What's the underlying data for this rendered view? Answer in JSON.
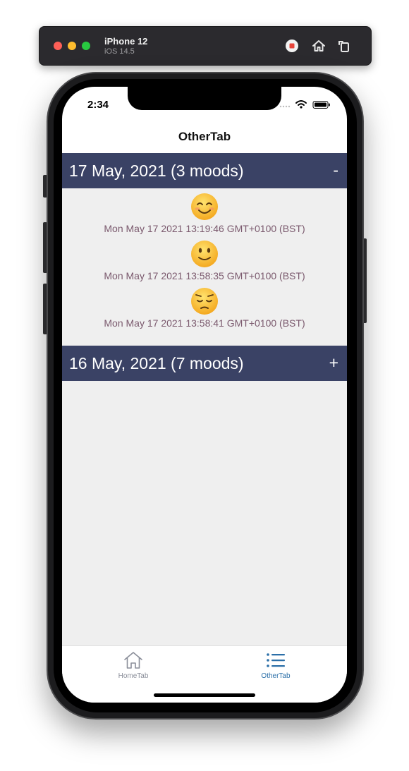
{
  "simulator": {
    "device": "iPhone 12",
    "os": "iOS 14.5"
  },
  "status_bar": {
    "time": "2:34"
  },
  "nav": {
    "title": "OtherTab"
  },
  "sections": [
    {
      "label": "17 May, 2021 (3 moods)",
      "toggle": "-",
      "expanded": true,
      "moods": [
        {
          "emoji_icon": "smiling-face-icon",
          "timestamp": "Mon May 17 2021 13:19:46 GMT+0100 (BST)"
        },
        {
          "emoji_icon": "slightly-smiling-face-icon",
          "timestamp": "Mon May 17 2021 13:58:35 GMT+0100 (BST)"
        },
        {
          "emoji_icon": "pensive-face-icon",
          "timestamp": "Mon May 17 2021 13:58:41 GMT+0100 (BST)"
        }
      ]
    },
    {
      "label": "16 May, 2021 (7 moods)",
      "toggle": "+",
      "expanded": false,
      "moods": []
    }
  ],
  "tabbar": {
    "tabs": [
      {
        "label": "HomeTab",
        "icon": "home-icon",
        "active": false
      },
      {
        "label": "OtherTab",
        "icon": "list-icon",
        "active": true
      }
    ]
  },
  "colors": {
    "section_header": "#3a4265",
    "content_bg": "#efefef",
    "timestamp_text": "#7b5a6e",
    "active_tab": "#2b6fa8",
    "inactive_tab": "#8a8e99"
  }
}
